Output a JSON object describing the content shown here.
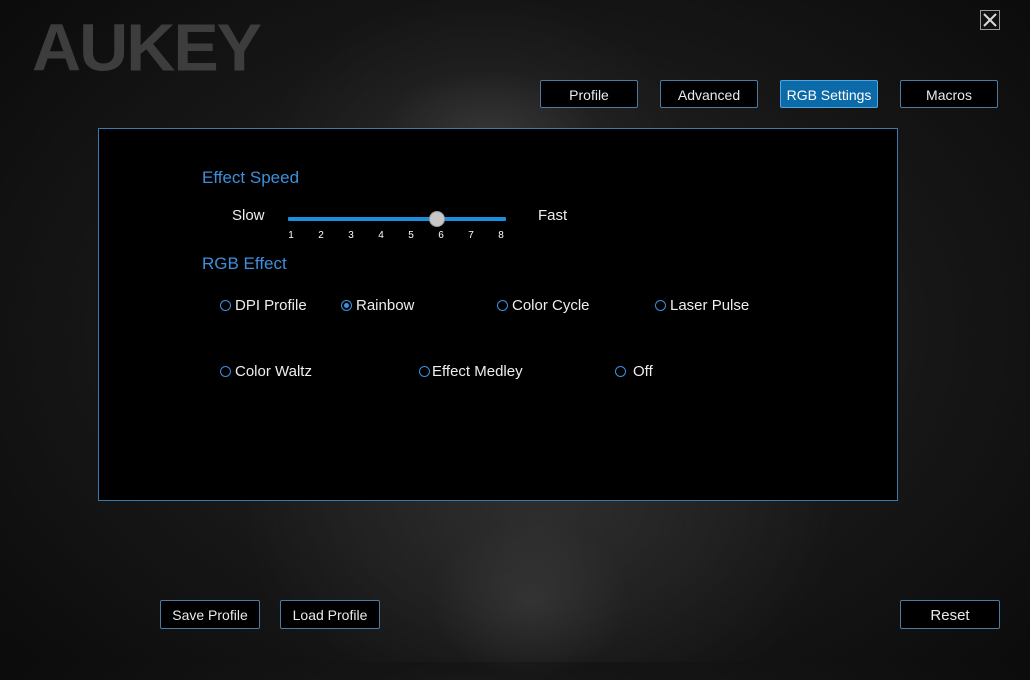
{
  "brand": {
    "logo_text": "AUKEY"
  },
  "window": {
    "close_icon": "close-icon"
  },
  "tabs": [
    {
      "label": "Profile",
      "active": false
    },
    {
      "label": "Advanced",
      "active": false
    },
    {
      "label": "RGB Settings",
      "active": true
    },
    {
      "label": "Macros",
      "active": false
    }
  ],
  "effect_speed": {
    "title": "Effect Speed",
    "min_label": "Slow",
    "max_label": "Fast",
    "ticks": [
      "1",
      "2",
      "3",
      "4",
      "5",
      "6",
      "7",
      "8"
    ],
    "value": 6
  },
  "rgb_effect": {
    "title": "RGB Effect",
    "options": [
      {
        "label": "DPI Profile",
        "selected": false
      },
      {
        "label": "Rainbow",
        "selected": true
      },
      {
        "label": "Color Cycle",
        "selected": false
      },
      {
        "label": "Laser Pulse",
        "selected": false
      },
      {
        "label": "Color Waltz",
        "selected": false
      },
      {
        "label": "Effect Medley",
        "selected": false
      },
      {
        "label": "Off",
        "selected": false
      }
    ]
  },
  "footer": {
    "save_profile": "Save Profile",
    "load_profile": "Load Profile",
    "reset": "Reset"
  },
  "colors": {
    "accent": "#3d8fdb",
    "active_tab": "#0c6aa8",
    "slider": "#1a8fe0"
  }
}
